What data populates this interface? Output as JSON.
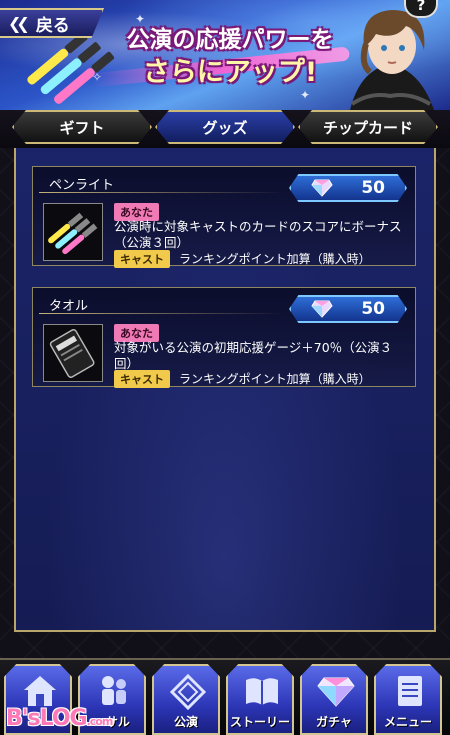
{
  "header": {
    "back_label": "戻る",
    "help_label": "?",
    "banner_line1": "公演の応援パワーを",
    "banner_line2": "さらにアップ!"
  },
  "tabs": [
    {
      "label": "ギフト",
      "active": false
    },
    {
      "label": "グッズ",
      "active": true
    },
    {
      "label": "チップカード",
      "active": false
    }
  ],
  "items": [
    {
      "name": "ペンライト",
      "price": "50",
      "target_tag": "あなた",
      "description": "公演時に対象キャストのカードのスコアにボーナス（公演３回）",
      "cast_tag": "キャスト",
      "ranking_text": "ランキングポイント加算（購入時）"
    },
    {
      "name": "タオル",
      "price": "50",
      "target_tag": "あなた",
      "description": "対象がいる公演の初期応援ゲージ＋70％（公演３回）",
      "cast_tag": "キャスト",
      "ranking_text": "ランキングポイント加算（購入時）"
    }
  ],
  "nav": [
    {
      "label": "",
      "icon": "home-icon"
    },
    {
      "label": "ーサル",
      "icon": "rehearsal-icon"
    },
    {
      "label": "公演",
      "icon": "performance-icon"
    },
    {
      "label": "ストーリー",
      "icon": "story-book-icon"
    },
    {
      "label": "ガチャ",
      "icon": "gacha-diamond-icon"
    },
    {
      "label": "メニュー",
      "icon": "menu-notepad-icon"
    }
  ],
  "watermark": {
    "text": "B'sLOG",
    "suffix": ".com"
  },
  "colors": {
    "panel": "#1b2468",
    "gold_border": "#b9a66a",
    "price_badge": "#2e6ed6",
    "tag_anata": "#f07ab6",
    "tag_cast": "#f1c94b",
    "nav_button": "#2c36b6"
  }
}
